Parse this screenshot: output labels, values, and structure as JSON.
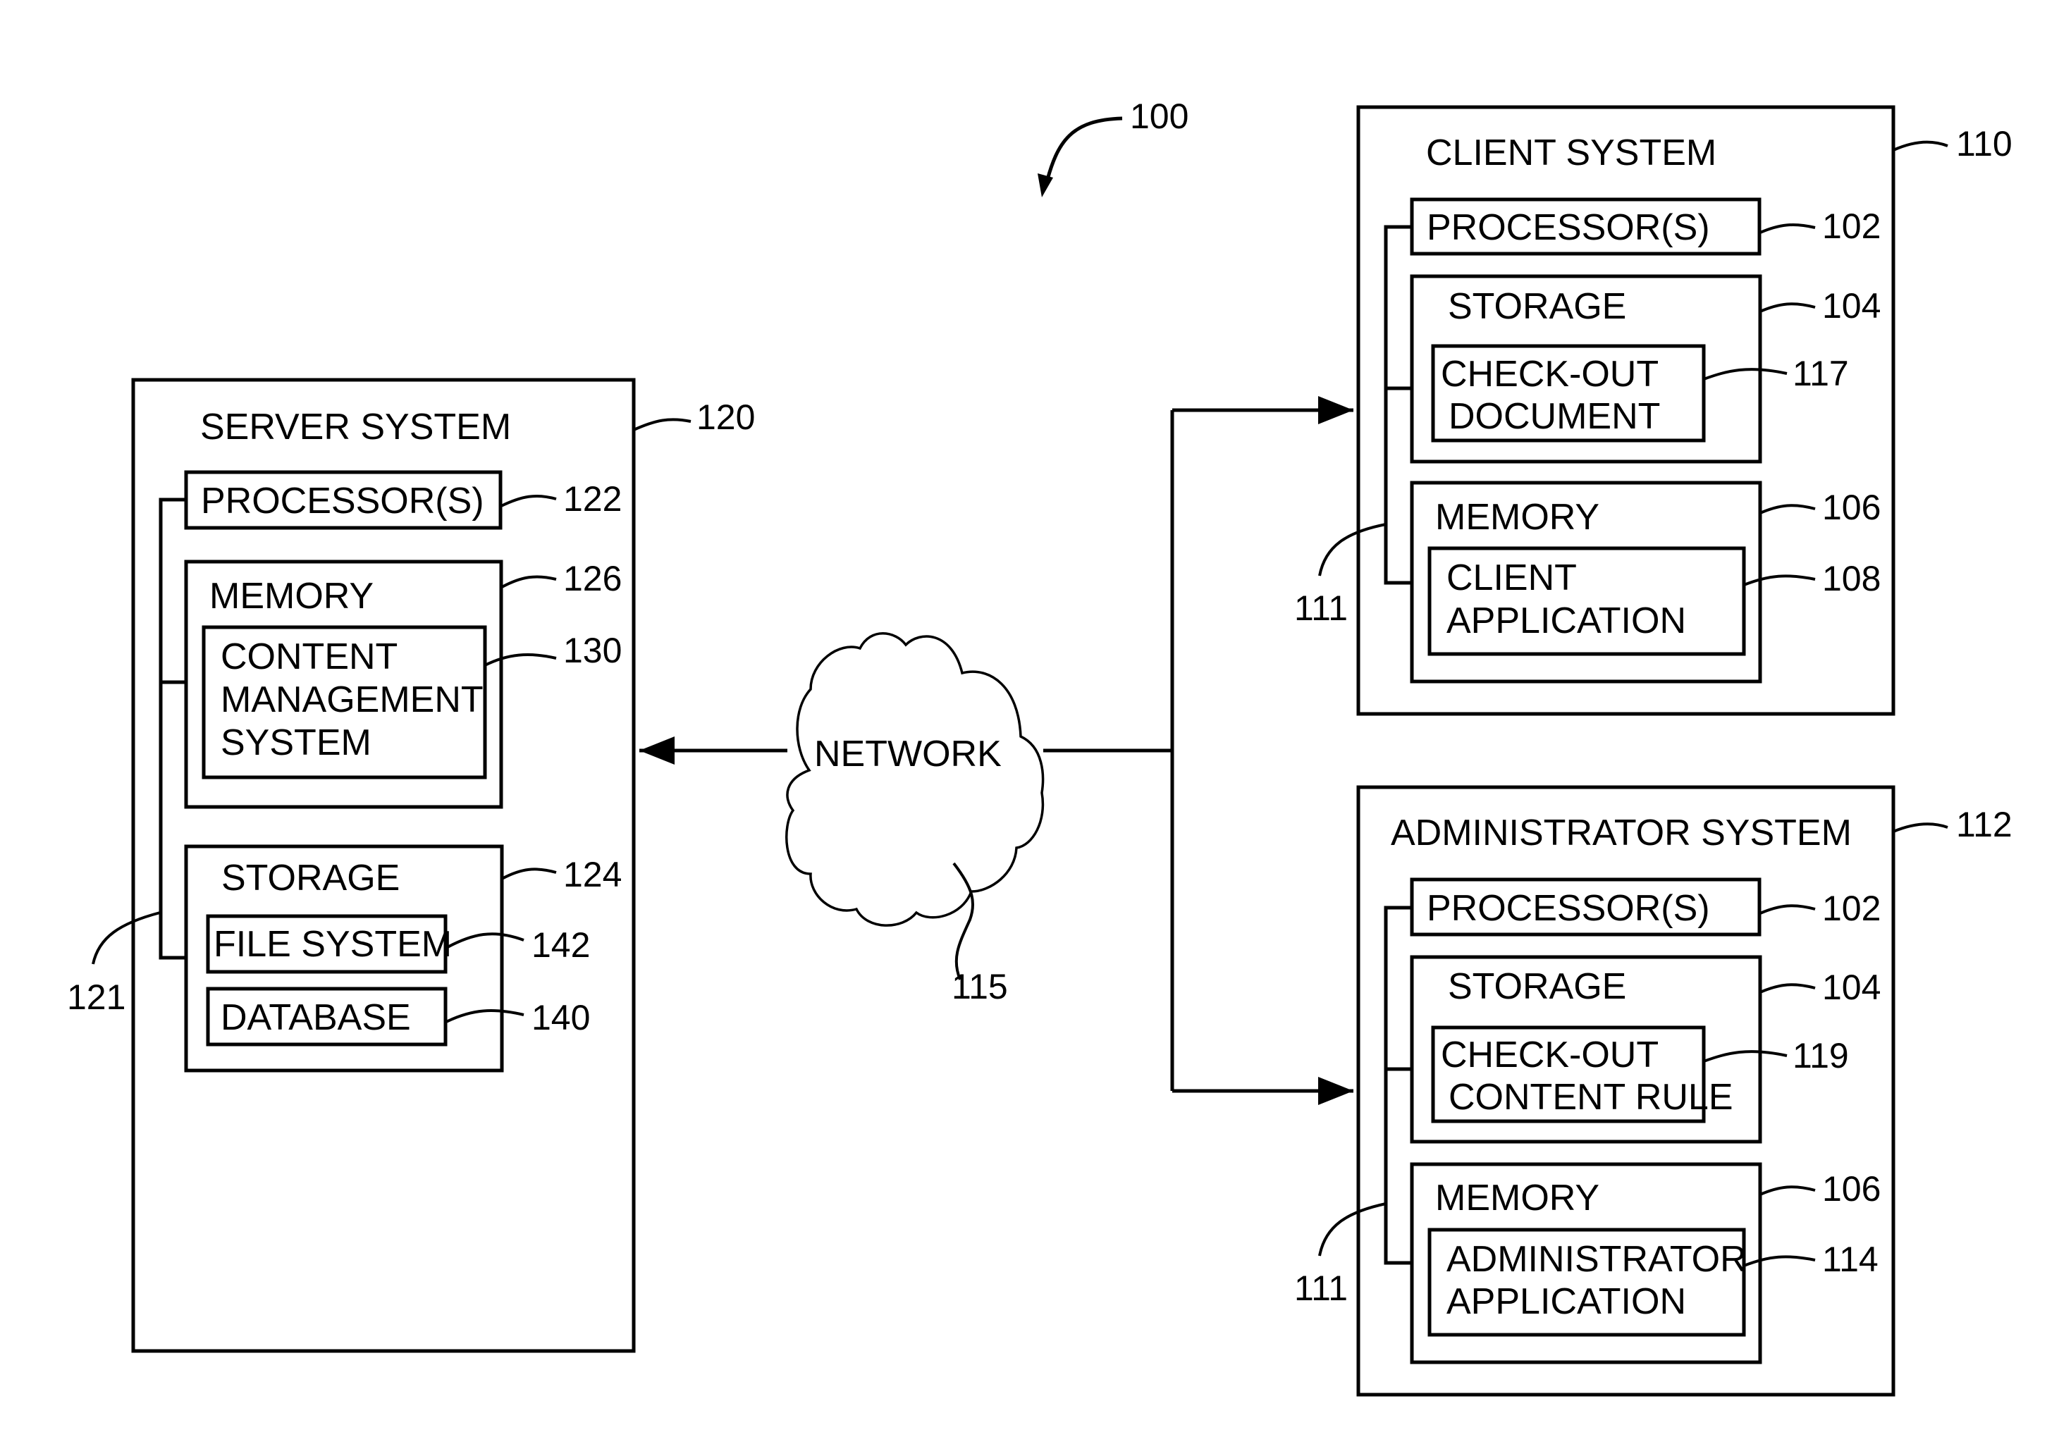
{
  "figure": {
    "ref": "100",
    "network": {
      "label": "NETWORK",
      "ref": "115"
    },
    "server": {
      "title": "SERVER SYSTEM",
      "ref": "120",
      "bus_ref": "121",
      "processor": {
        "label": "PROCESSOR(S)",
        "ref": "122"
      },
      "memory": {
        "label": "MEMORY",
        "ref": "126",
        "cms": {
          "lines": [
            "CONTENT",
            "MANAGEMENT",
            "SYSTEM"
          ],
          "ref": "130"
        }
      },
      "storage": {
        "label": "STORAGE",
        "ref": "124",
        "file_system": {
          "label": "FILE SYSTEM",
          "ref": "142"
        },
        "database": {
          "label": "DATABASE",
          "ref": "140"
        }
      }
    },
    "client": {
      "title": "CLIENT SYSTEM",
      "ref": "110",
      "bus_ref": "111",
      "processor": {
        "label": "PROCESSOR(S)",
        "ref": "102"
      },
      "storage": {
        "label": "STORAGE",
        "ref": "104",
        "item": {
          "lines": [
            "CHECK-OUT",
            "DOCUMENT"
          ],
          "ref": "117"
        }
      },
      "memory": {
        "label": "MEMORY",
        "ref": "106",
        "item": {
          "lines": [
            "CLIENT",
            "APPLICATION"
          ],
          "ref": "108"
        }
      }
    },
    "admin": {
      "title": "ADMINISTRATOR SYSTEM",
      "ref": "112",
      "bus_ref": "111",
      "processor": {
        "label": "PROCESSOR(S)",
        "ref": "102"
      },
      "storage": {
        "label": "STORAGE",
        "ref": "104",
        "item": {
          "lines": [
            "CHECK-OUT",
            "CONTENT RULE"
          ],
          "ref": "119"
        }
      },
      "memory": {
        "label": "MEMORY",
        "ref": "106",
        "item": {
          "lines": [
            "ADMINISTRATOR",
            "APPLICATION"
          ],
          "ref": "114"
        }
      }
    }
  }
}
